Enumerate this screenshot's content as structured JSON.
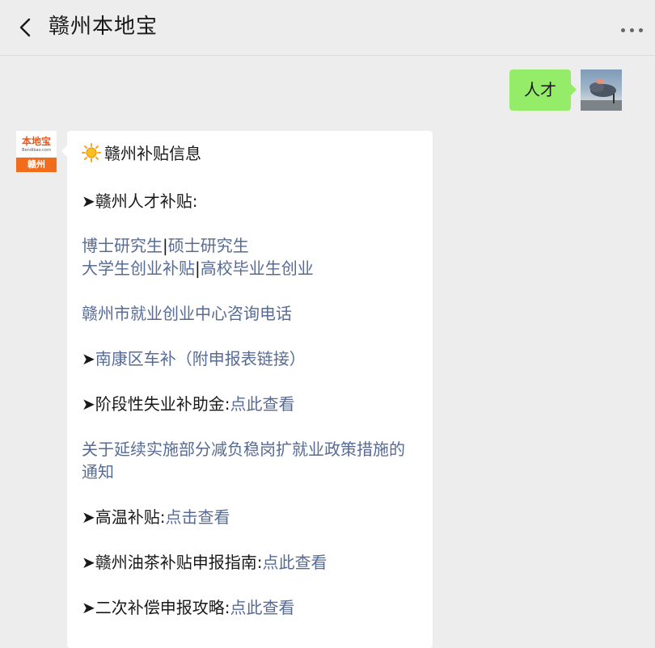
{
  "header": {
    "title": "赣州本地宝"
  },
  "messages": {
    "user": {
      "text": "人才"
    },
    "bot": {
      "avatar_logo": "本地宝",
      "avatar_domain": "Bendibao.com",
      "avatar_city": "赣州",
      "heading": "赣州补贴信息",
      "talent_title": "➤赣州人才补贴:",
      "link_phd": "博士研究生",
      "sep1": "|",
      "link_master": "硕士研究生",
      "link_startup": "大学生创业补贴",
      "sep2": "|",
      "link_grad": "高校毕业生创业",
      "link_phone": "赣州市就业创业中心咨询电话",
      "arrow": "➤",
      "link_nankang": "南康区车补（附申报表链接）",
      "unemp_label": "➤阶段性失业补助金:",
      "unemp_link": "点此查看",
      "policy_link_1": "关于延续实施部分减负稳岗扩就业政策措施的",
      "policy_link_2": "通知",
      "heat_label": "➤高温补贴:",
      "heat_link": "点击查看",
      "tea_label": "➤赣州油茶补贴申报指南:",
      "tea_link": "点此查看",
      "comp_label": "➤二次补偿申报攻略:",
      "comp_link": "点此查看"
    }
  },
  "colors": {
    "link": "#576b95",
    "user_bubble": "#95ec69",
    "background": "#ededed"
  }
}
